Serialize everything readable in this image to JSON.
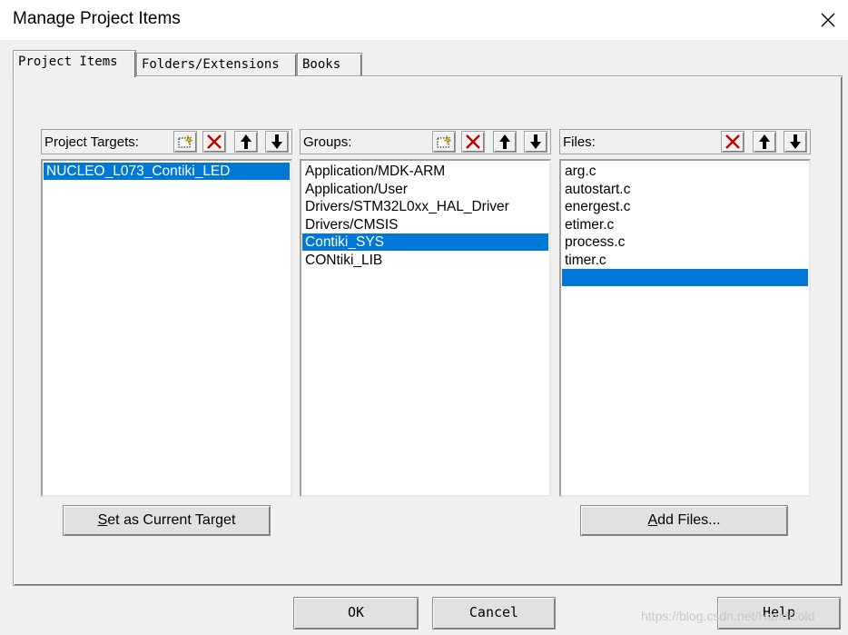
{
  "window": {
    "title": "Manage Project Items"
  },
  "tabs": [
    {
      "label": "Project Items",
      "active": true
    },
    {
      "label": "Folders/Extensions",
      "active": false
    },
    {
      "label": "Books",
      "active": false
    }
  ],
  "targets": {
    "header": "Project Targets:",
    "items": [
      "NUCLEO_L073_Contiki_LED"
    ],
    "selected_index": 0,
    "button_prefix": "S",
    "button_rest": "et as Current Target"
  },
  "groups": {
    "header": "Groups:",
    "items": [
      "Application/MDK-ARM",
      "Application/User",
      "Drivers/STM32L0xx_HAL_Driver",
      "Drivers/CMSIS",
      "Contiki_SYS",
      "CONtiki_LIB"
    ],
    "selected_index": 4
  },
  "files": {
    "header": "Files:",
    "items": [
      "arg.c",
      "autostart.c",
      "energest.c",
      "etimer.c",
      "process.c",
      "timer.c",
      ""
    ],
    "selected_index": 6,
    "button_prefix": "A",
    "button_rest": "dd Files..."
  },
  "footer": {
    "ok": "OK",
    "cancel": "Cancel",
    "help": "Help"
  },
  "watermark": "https://blog.csdn.net/HandCold",
  "colors": {
    "selection": "#0078d7",
    "delete": "#c00000"
  }
}
